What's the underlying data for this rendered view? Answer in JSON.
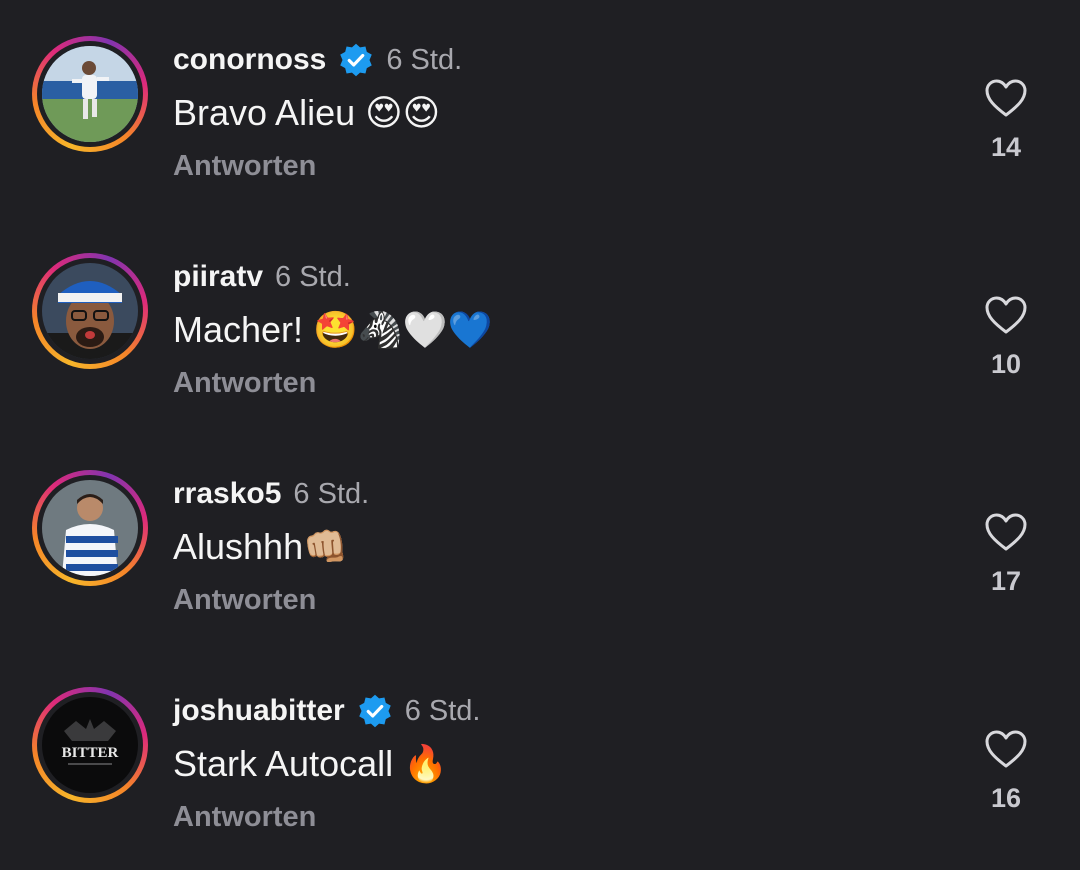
{
  "comments": [
    {
      "username": "conornoss",
      "verified": true,
      "time": "6 Std.",
      "text": "Bravo Alieu 😍😍",
      "reply_label": "Antworten",
      "likes": "14",
      "avatar_icon": "soccer-player-photo"
    },
    {
      "username": "piiratv",
      "verified": false,
      "time": "6 Std.",
      "text": "Macher! 🤩🦓🤍💙",
      "reply_label": "Antworten",
      "likes": "10",
      "avatar_icon": "fan-with-scarf-photo"
    },
    {
      "username": "rrasko5",
      "verified": false,
      "time": "6 Std.",
      "text": "Alushhh👊🏼",
      "reply_label": "Antworten",
      "likes": "17",
      "avatar_icon": "player-in-striped-jersey-photo"
    },
    {
      "username": "joshuabitter",
      "verified": true,
      "time": "6 Std.",
      "text": "Stark Autocall 🔥",
      "reply_label": "Antworten",
      "likes": "16",
      "avatar_icon": "bitter-logo",
      "avatar_text": "BITTER"
    }
  ],
  "colors": {
    "background": "#1f1f23",
    "verified_badge": "#1d9bf0",
    "secondary_text": "#a8a8ae"
  }
}
